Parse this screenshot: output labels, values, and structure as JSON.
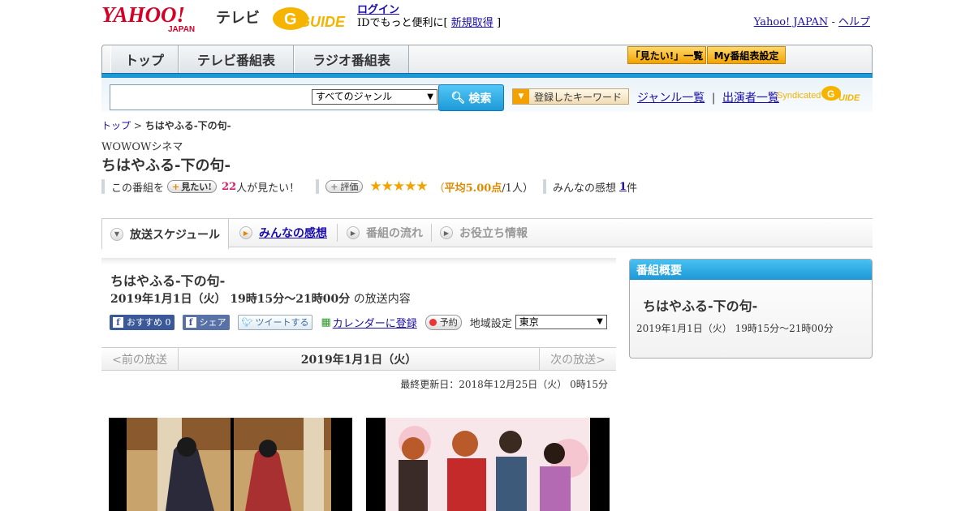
{
  "header": {
    "logo_yahoo": "YAHOO!",
    "logo_japan": "JAPAN",
    "logo_tv": "テレビ",
    "logo_gguide": "GUIDE",
    "login_label": "ログイン",
    "id_text": "IDでもっと便利に[",
    "register_label": "新規取得",
    "id_text_end": "]",
    "yahoo_japan_link": "Yahoo! JAPAN",
    "dash": " - ",
    "help_link": "ヘルプ"
  },
  "nav": {
    "tabs": [
      {
        "label": "トップ"
      },
      {
        "label": "テレビ番組表"
      },
      {
        "label": "ラジオ番組表"
      }
    ],
    "want_list_label": "「見たい!」一覧",
    "my_schedule_label": "My番組表設定"
  },
  "search": {
    "input_value": "",
    "genre_selected": "すべてのジャンル",
    "search_button": "検索",
    "keyword_button": "登録したキーワード",
    "genre_list_link": "ジャンル一覧",
    "divider": "|",
    "performer_link": "出演者一覧",
    "syndicated": "Syndicated"
  },
  "breadcrumb": {
    "top": "トップ",
    "sep": " > ",
    "current": "ちはやふる-下の句-"
  },
  "program": {
    "channel": "WOWOWシネマ",
    "title": "ちはやふる-下の句-",
    "this_program": "この番組を",
    "want_button": "見たい!",
    "want_count": "22",
    "want_suffix": "人が見たい！",
    "rate_button": "評価",
    "stars": "★★★★★",
    "avg_open": "（",
    "avg_label": "平均5.00点",
    "avg_people": "/1人）",
    "impressions_label": "みんなの感想",
    "impressions_count": "1",
    "impressions_suffix": "件"
  },
  "tabs": [
    {
      "label": "放送スケジュール"
    },
    {
      "label": "みんなの感想"
    },
    {
      "label": "番組の流れ"
    },
    {
      "label": "お役立ち情報"
    }
  ],
  "broadcast": {
    "title": "ちはやふる-下の句-",
    "date_time": "2019年1月1日（火） 19時15分～21時00分",
    "date_suffix": " の放送内容",
    "fb_recommend": "おすすめ 0",
    "fb_share": "シェア",
    "tweet": "ツイートする",
    "calendar": "カレンダーに登録",
    "reserve": "予約",
    "region_label": "地域設定",
    "region_selected": "東京",
    "prev": "<前の放送",
    "current_date": "2019年1月1日（火）",
    "next": "次の放送>",
    "last_updated": "最終更新日：2018年12月25日（火） 0時15分"
  },
  "panel": {
    "header": "番組概要",
    "title": "ちはやふる-下の句-",
    "date_time": "2019年1月1日（火） 19時15分～21時00分"
  }
}
